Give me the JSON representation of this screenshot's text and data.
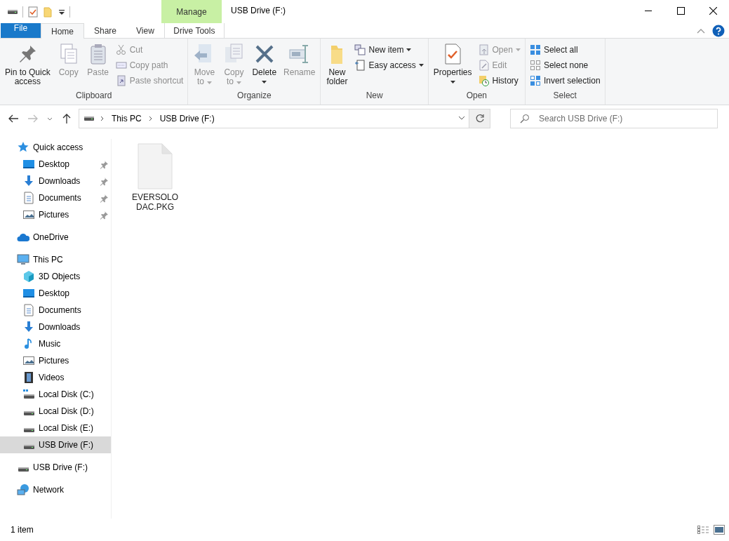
{
  "window": {
    "title": "USB Drive (F:)",
    "context_header": "Manage"
  },
  "tabs": [
    {
      "label": "File",
      "kind": "file",
      "selected": false
    },
    {
      "label": "Home",
      "kind": "tab",
      "selected": true
    },
    {
      "label": "Share",
      "kind": "tab",
      "selected": false
    },
    {
      "label": "View",
      "kind": "tab",
      "selected": false
    },
    {
      "label": "Drive Tools",
      "kind": "context",
      "selected": false
    }
  ],
  "ribbon": [
    {
      "label": "Clipboard",
      "items": [
        {
          "kind": "large",
          "label": "Pin to Quick\naccess",
          "disabled": false,
          "dropdown": false
        },
        {
          "kind": "large",
          "label": "Copy",
          "disabled": true,
          "dropdown": false
        },
        {
          "kind": "large",
          "label": "Paste",
          "disabled": true,
          "dropdown": false
        },
        {
          "kind": "small",
          "label": "Cut",
          "disabled": true,
          "dropdown": false
        },
        {
          "kind": "small",
          "label": "Copy path",
          "disabled": true,
          "dropdown": false
        },
        {
          "kind": "small",
          "label": "Paste shortcut",
          "disabled": true,
          "dropdown": false
        }
      ]
    },
    {
      "label": "Organize",
      "items": [
        {
          "kind": "large",
          "label": "Move\nto",
          "disabled": true,
          "dropdown": true
        },
        {
          "kind": "large",
          "label": "Copy\nto",
          "disabled": true,
          "dropdown": true
        },
        {
          "kind": "large",
          "label": "Delete",
          "disabled": false,
          "dropdown": true
        },
        {
          "kind": "large",
          "label": "Rename",
          "disabled": true,
          "dropdown": false
        }
      ]
    },
    {
      "label": "New",
      "items": [
        {
          "kind": "large",
          "label": "New\nfolder",
          "disabled": false,
          "dropdown": false
        },
        {
          "kind": "small",
          "label": "New item",
          "disabled": false,
          "dropdown": true
        },
        {
          "kind": "small",
          "label": "Easy access",
          "disabled": false,
          "dropdown": true
        }
      ]
    },
    {
      "label": "Open",
      "items": [
        {
          "kind": "large",
          "label": "Properties",
          "disabled": false,
          "dropdown": true
        },
        {
          "kind": "small",
          "label": "Open",
          "disabled": true,
          "dropdown": true
        },
        {
          "kind": "small",
          "label": "Edit",
          "disabled": true,
          "dropdown": false
        },
        {
          "kind": "small",
          "label": "History",
          "disabled": false,
          "dropdown": false
        }
      ]
    },
    {
      "label": "Select",
      "items": [
        {
          "kind": "small",
          "label": "Select all",
          "disabled": false,
          "dropdown": false
        },
        {
          "kind": "small",
          "label": "Select none",
          "disabled": false,
          "dropdown": false
        },
        {
          "kind": "small",
          "label": "Invert selection",
          "disabled": false,
          "dropdown": false
        }
      ]
    }
  ],
  "address_bar": {
    "path": [
      "This PC",
      "USB Drive (F:)"
    ]
  },
  "search": {
    "placeholder": "Search USB Drive (F:)"
  },
  "navigation": [
    {
      "label": "Quick access",
      "kind": "star",
      "selected": false,
      "children": [
        {
          "label": "Desktop",
          "kind": "desktop",
          "selected": false,
          "pinned": true
        },
        {
          "label": "Downloads",
          "kind": "downloads",
          "selected": false,
          "pinned": true
        },
        {
          "label": "Documents",
          "kind": "documents",
          "selected": false,
          "pinned": true
        },
        {
          "label": "Pictures",
          "kind": "pictures",
          "selected": false,
          "pinned": true
        }
      ]
    },
    {
      "label": "OneDrive",
      "kind": "cloud",
      "selected": false
    },
    {
      "label": "This PC",
      "kind": "pc",
      "selected": false,
      "children": [
        {
          "label": "3D Objects",
          "kind": "cube",
          "selected": false
        },
        {
          "label": "Desktop",
          "kind": "desktop",
          "selected": false
        },
        {
          "label": "Documents",
          "kind": "documents",
          "selected": false
        },
        {
          "label": "Downloads",
          "kind": "downloads",
          "selected": false
        },
        {
          "label": "Music",
          "kind": "music",
          "selected": false
        },
        {
          "label": "Pictures",
          "kind": "pictures",
          "selected": false
        },
        {
          "label": "Videos",
          "kind": "videos",
          "selected": false
        },
        {
          "label": "Local Disk (C:)",
          "kind": "system-disk",
          "selected": false
        },
        {
          "label": "Local Disk (D:)",
          "kind": "disk",
          "selected": false
        },
        {
          "label": "Local Disk (E:)",
          "kind": "disk",
          "selected": false
        },
        {
          "label": "USB Drive (F:)",
          "kind": "disk",
          "selected": true
        }
      ]
    },
    {
      "label": "USB Drive (F:)",
      "kind": "disk",
      "selected": false
    },
    {
      "label": "Network",
      "kind": "network",
      "selected": false
    }
  ],
  "files": [
    {
      "name": "EVERSOLODAC.PKG"
    }
  ],
  "status_bar": {
    "count": "1 item"
  }
}
